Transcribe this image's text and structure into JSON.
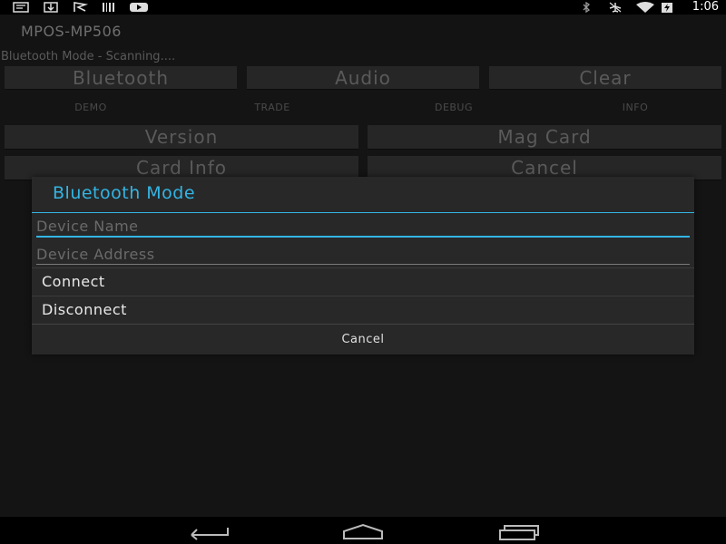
{
  "status_bar": {
    "left_icons": [
      "message-icon",
      "download-icon",
      "flag-icon",
      "barcode-icon",
      "youtube-icon"
    ],
    "right_icons": [
      "bluetooth-icon",
      "airplane-mode-icon",
      "wifi-icon",
      "battery-charging-icon"
    ],
    "time": "1:06"
  },
  "app": {
    "title": "MPOS-MP506",
    "status": "Bluetooth Mode  - Scanning...."
  },
  "buttons": {
    "bluetooth": "Bluetooth",
    "audio": "Audio",
    "clear": "Clear",
    "version": "Version",
    "mag_card": "Mag Card",
    "card_info": "Card Info",
    "cancel": "Cancel"
  },
  "tabs": [
    "DEMO",
    "TRADE",
    "DEBUG",
    "INFO"
  ],
  "dialog": {
    "title": "Bluetooth Mode",
    "device_name_placeholder": "Device Name",
    "device_address_placeholder": "Device Address",
    "items": [
      "Connect",
      "Disconnect"
    ],
    "cancel_label": "Cancel",
    "accent_color": "#33b5e5"
  },
  "nav_bar": {
    "icons": [
      "back-icon",
      "home-icon",
      "recent-apps-icon"
    ]
  }
}
